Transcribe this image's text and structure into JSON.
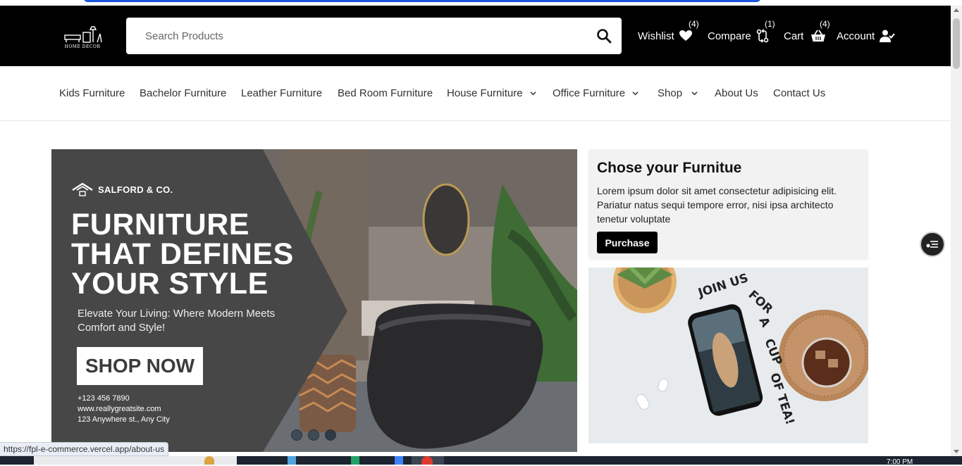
{
  "header": {
    "logo_text": "HOME DECOR",
    "search_placeholder": "Search Products",
    "wishlist": {
      "label": "Wishlist",
      "count": "(4)"
    },
    "compare": {
      "label": "Compare",
      "count": "(1)"
    },
    "cart": {
      "label": "Cart",
      "count": "(4)"
    },
    "account": {
      "label": "Account"
    }
  },
  "nav": {
    "items": [
      {
        "label": "Kids Furniture"
      },
      {
        "label": "Bachelor Furniture"
      },
      {
        "label": "Leather Furniture"
      },
      {
        "label": "Bed Room Furniture"
      },
      {
        "label": "House Furniture"
      },
      {
        "label": "Office Furniture"
      },
      {
        "label": "Shop"
      },
      {
        "label": "About Us"
      },
      {
        "label": "Contact Us"
      }
    ]
  },
  "hero": {
    "brand": "SALFORD & CO.",
    "headline_1": "FURNITURE",
    "headline_2": "THAT DEFINES",
    "headline_3": "YOUR STYLE",
    "subline": "Elevate Your Living: Where Modern Meets Comfort and Style!",
    "cta": "SHOP NOW",
    "phone": "+123 456 7890",
    "website": "www.reallygreatsite.com",
    "address": "123 Anywhere st., Any City",
    "slides": 3,
    "active_slide": 1
  },
  "card": {
    "title": "Chose your Furnitue",
    "text": "Lorem ipsum dolor sit amet consectetur adipisicing elit. Pariatur natus sequi tempore error, nisi ipsa architecto tenetur voluptate",
    "button": "Purchase"
  },
  "promo": {
    "text": "JOIN US FOR A CUP OF TEA!"
  },
  "status_url": "https://fpl-e-commerce.vercel.app/about-us",
  "taskbar": {
    "clock": "7:00 PM"
  },
  "colors": {
    "header_bg": "#000000",
    "accent_top": "#1a56db",
    "card_bg": "#f2f2f3"
  }
}
